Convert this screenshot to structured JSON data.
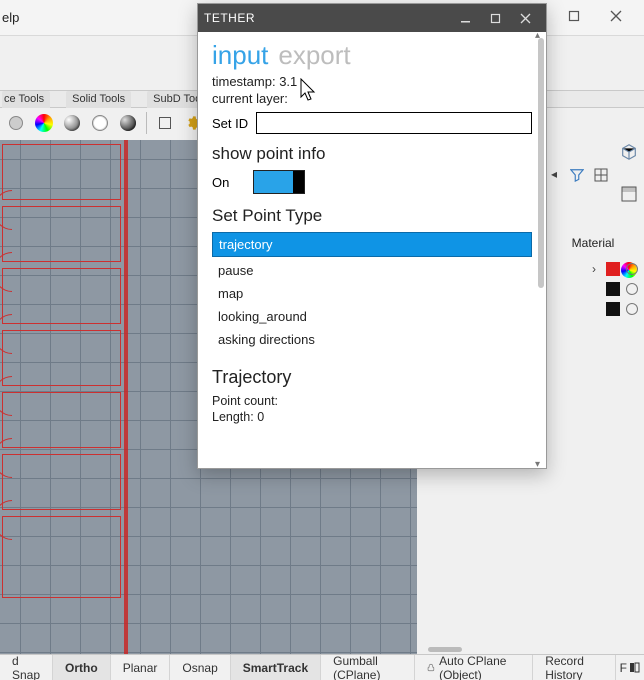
{
  "host": {
    "menu_help": "elp",
    "tool_tabs": [
      "ce Tools",
      "Solid Tools",
      "SubD Tools"
    ]
  },
  "right": {
    "material_header": "Material",
    "layers": [
      {
        "color": "#e02020"
      },
      {
        "color": "#111111"
      },
      {
        "color": "#111111"
      }
    ]
  },
  "statusbar": {
    "snap": "d Snap",
    "ortho": "Ortho",
    "planar": "Planar",
    "osnap": "Osnap",
    "smarttrack": "SmartTrack",
    "gumball": "Gumball (CPlane)",
    "autocplane": "Auto CPlane (Object)",
    "record": "Record History",
    "last": "F"
  },
  "dialog": {
    "title": "TETHER",
    "tabs": {
      "input": "input",
      "export": "export"
    },
    "timestamp_label": "timestamp: ",
    "timestamp_value": "3.1",
    "current_layer_label": "current layer:",
    "current_layer_value": "",
    "setid_label": "Set ID",
    "setid_value": "",
    "show_point_info": "show point info",
    "on_label": "On",
    "set_point_type": "Set Point Type",
    "options": [
      "trajectory",
      "pause",
      "map",
      "looking_around",
      "asking directions"
    ],
    "selected_option_index": 0,
    "trajectory_header": "Trajectory",
    "point_count_label": "Point count:",
    "point_count_value": "",
    "length_label": "Length: ",
    "length_value": "0"
  }
}
